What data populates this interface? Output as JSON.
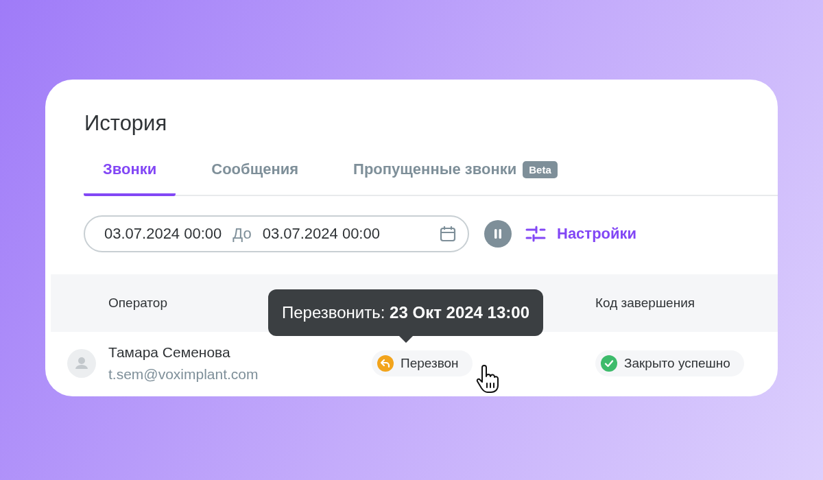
{
  "title": "История",
  "tabs": [
    {
      "label": "Звонки",
      "selected": true
    },
    {
      "label": "Сообщения",
      "selected": false
    },
    {
      "label": "Пропущенные звонки",
      "selected": false,
      "badge": "Beta"
    }
  ],
  "filter": {
    "from": "03.07.2024 00:00",
    "separator": "До",
    "to": "03.07.2024 00:00",
    "paused": true,
    "settings": "Настройки"
  },
  "table": {
    "columns": [
      "Оператор",
      "Код завершения"
    ],
    "rows": [
      {
        "name": "Тамара Семенова",
        "email": "t.sem@voximplant.com",
        "status": "Перезвон",
        "result": "Закрыто успешно"
      }
    ]
  },
  "tooltip": "Перезвонить: **23 Окт 2024 13:00**"
}
